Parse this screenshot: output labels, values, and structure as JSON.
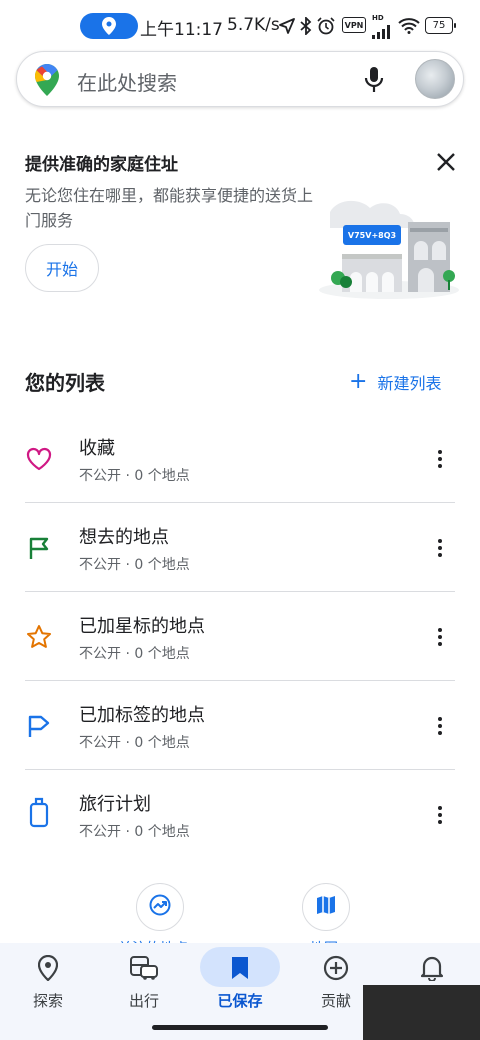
{
  "status_bar": {
    "time": "上午11:17",
    "network_speed": "5.7K/s",
    "vpn": "VPN",
    "hd": "HD",
    "battery": "75"
  },
  "search": {
    "placeholder": "在此处搜索"
  },
  "promo": {
    "title": "提供准确的家庭住址",
    "body": "无论您住在哪里，都能获享便捷的送货上门服务",
    "button": "开始",
    "illustration_label": "V75V+8Q3"
  },
  "lists_section": {
    "title": "您的列表",
    "new_list": "新建列表",
    "items": [
      {
        "title": "收藏",
        "meta": "不公开 · 0 个地点",
        "icon": "heart-icon",
        "color": "#d01884"
      },
      {
        "title": "想去的地点",
        "meta": "不公开 · 0 个地点",
        "icon": "flag-icon",
        "color": "#188038"
      },
      {
        "title": "已加星标的地点",
        "meta": "不公开 · 0 个地点",
        "icon": "star-icon",
        "color": "#e37400"
      },
      {
        "title": "已加标签的地点",
        "meta": "不公开 · 0 个地点",
        "icon": "label-flag-icon",
        "color": "#1a73e8"
      },
      {
        "title": "旅行计划",
        "meta": "不公开 · 0 个地点",
        "icon": "suitcase-icon",
        "color": "#1a73e8"
      }
    ]
  },
  "bottom_shortcuts": [
    {
      "label": "关注的地点",
      "icon": "trending-icon"
    },
    {
      "label": "地图",
      "icon": "map-icon"
    }
  ],
  "bottom_nav": {
    "items": [
      {
        "label": "探索",
        "icon": "location-pin-icon"
      },
      {
        "label": "出行",
        "icon": "commute-icon"
      },
      {
        "label": "已保存",
        "icon": "bookmark-icon",
        "active": true
      },
      {
        "label": "贡献",
        "icon": "add-circle-icon"
      },
      {
        "label": "",
        "icon": "bell-icon"
      }
    ]
  },
  "colors": {
    "accent": "#1a73e8",
    "active_pill": "#d3e3fd",
    "nav_background": "#f3f6fc"
  }
}
